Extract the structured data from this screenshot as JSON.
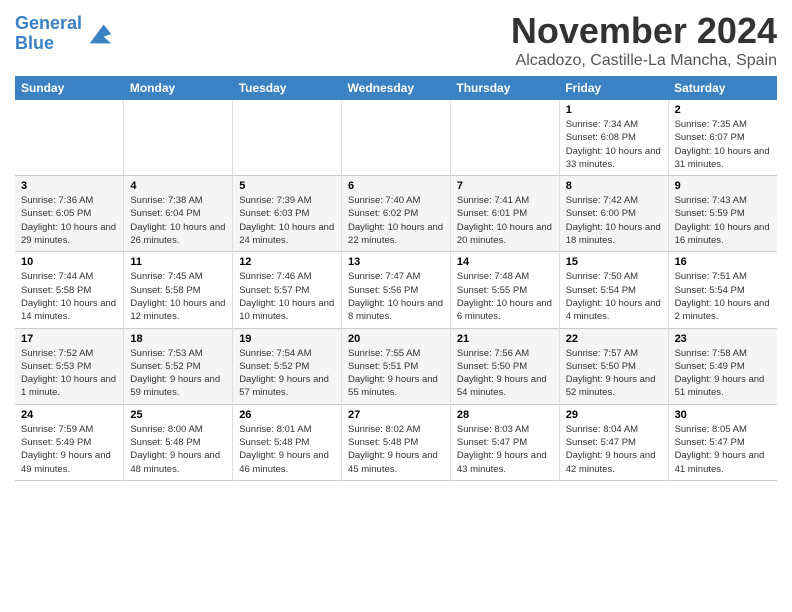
{
  "header": {
    "logo_line1": "General",
    "logo_line2": "Blue",
    "month_year": "November 2024",
    "location": "Alcadozo, Castille-La Mancha, Spain"
  },
  "weekdays": [
    "Sunday",
    "Monday",
    "Tuesday",
    "Wednesday",
    "Thursday",
    "Friday",
    "Saturday"
  ],
  "weeks": [
    [
      {
        "day": "",
        "info": ""
      },
      {
        "day": "",
        "info": ""
      },
      {
        "day": "",
        "info": ""
      },
      {
        "day": "",
        "info": ""
      },
      {
        "day": "",
        "info": ""
      },
      {
        "day": "1",
        "info": "Sunrise: 7:34 AM\nSunset: 6:08 PM\nDaylight: 10 hours and 33 minutes."
      },
      {
        "day": "2",
        "info": "Sunrise: 7:35 AM\nSunset: 6:07 PM\nDaylight: 10 hours and 31 minutes."
      }
    ],
    [
      {
        "day": "3",
        "info": "Sunrise: 7:36 AM\nSunset: 6:05 PM\nDaylight: 10 hours and 29 minutes."
      },
      {
        "day": "4",
        "info": "Sunrise: 7:38 AM\nSunset: 6:04 PM\nDaylight: 10 hours and 26 minutes."
      },
      {
        "day": "5",
        "info": "Sunrise: 7:39 AM\nSunset: 6:03 PM\nDaylight: 10 hours and 24 minutes."
      },
      {
        "day": "6",
        "info": "Sunrise: 7:40 AM\nSunset: 6:02 PM\nDaylight: 10 hours and 22 minutes."
      },
      {
        "day": "7",
        "info": "Sunrise: 7:41 AM\nSunset: 6:01 PM\nDaylight: 10 hours and 20 minutes."
      },
      {
        "day": "8",
        "info": "Sunrise: 7:42 AM\nSunset: 6:00 PM\nDaylight: 10 hours and 18 minutes."
      },
      {
        "day": "9",
        "info": "Sunrise: 7:43 AM\nSunset: 5:59 PM\nDaylight: 10 hours and 16 minutes."
      }
    ],
    [
      {
        "day": "10",
        "info": "Sunrise: 7:44 AM\nSunset: 5:58 PM\nDaylight: 10 hours and 14 minutes."
      },
      {
        "day": "11",
        "info": "Sunrise: 7:45 AM\nSunset: 5:58 PM\nDaylight: 10 hours and 12 minutes."
      },
      {
        "day": "12",
        "info": "Sunrise: 7:46 AM\nSunset: 5:57 PM\nDaylight: 10 hours and 10 minutes."
      },
      {
        "day": "13",
        "info": "Sunrise: 7:47 AM\nSunset: 5:56 PM\nDaylight: 10 hours and 8 minutes."
      },
      {
        "day": "14",
        "info": "Sunrise: 7:48 AM\nSunset: 5:55 PM\nDaylight: 10 hours and 6 minutes."
      },
      {
        "day": "15",
        "info": "Sunrise: 7:50 AM\nSunset: 5:54 PM\nDaylight: 10 hours and 4 minutes."
      },
      {
        "day": "16",
        "info": "Sunrise: 7:51 AM\nSunset: 5:54 PM\nDaylight: 10 hours and 2 minutes."
      }
    ],
    [
      {
        "day": "17",
        "info": "Sunrise: 7:52 AM\nSunset: 5:53 PM\nDaylight: 10 hours and 1 minute."
      },
      {
        "day": "18",
        "info": "Sunrise: 7:53 AM\nSunset: 5:52 PM\nDaylight: 9 hours and 59 minutes."
      },
      {
        "day": "19",
        "info": "Sunrise: 7:54 AM\nSunset: 5:52 PM\nDaylight: 9 hours and 57 minutes."
      },
      {
        "day": "20",
        "info": "Sunrise: 7:55 AM\nSunset: 5:51 PM\nDaylight: 9 hours and 55 minutes."
      },
      {
        "day": "21",
        "info": "Sunrise: 7:56 AM\nSunset: 5:50 PM\nDaylight: 9 hours and 54 minutes."
      },
      {
        "day": "22",
        "info": "Sunrise: 7:57 AM\nSunset: 5:50 PM\nDaylight: 9 hours and 52 minutes."
      },
      {
        "day": "23",
        "info": "Sunrise: 7:58 AM\nSunset: 5:49 PM\nDaylight: 9 hours and 51 minutes."
      }
    ],
    [
      {
        "day": "24",
        "info": "Sunrise: 7:59 AM\nSunset: 5:49 PM\nDaylight: 9 hours and 49 minutes."
      },
      {
        "day": "25",
        "info": "Sunrise: 8:00 AM\nSunset: 5:48 PM\nDaylight: 9 hours and 48 minutes."
      },
      {
        "day": "26",
        "info": "Sunrise: 8:01 AM\nSunset: 5:48 PM\nDaylight: 9 hours and 46 minutes."
      },
      {
        "day": "27",
        "info": "Sunrise: 8:02 AM\nSunset: 5:48 PM\nDaylight: 9 hours and 45 minutes."
      },
      {
        "day": "28",
        "info": "Sunrise: 8:03 AM\nSunset: 5:47 PM\nDaylight: 9 hours and 43 minutes."
      },
      {
        "day": "29",
        "info": "Sunrise: 8:04 AM\nSunset: 5:47 PM\nDaylight: 9 hours and 42 minutes."
      },
      {
        "day": "30",
        "info": "Sunrise: 8:05 AM\nSunset: 5:47 PM\nDaylight: 9 hours and 41 minutes."
      }
    ]
  ]
}
